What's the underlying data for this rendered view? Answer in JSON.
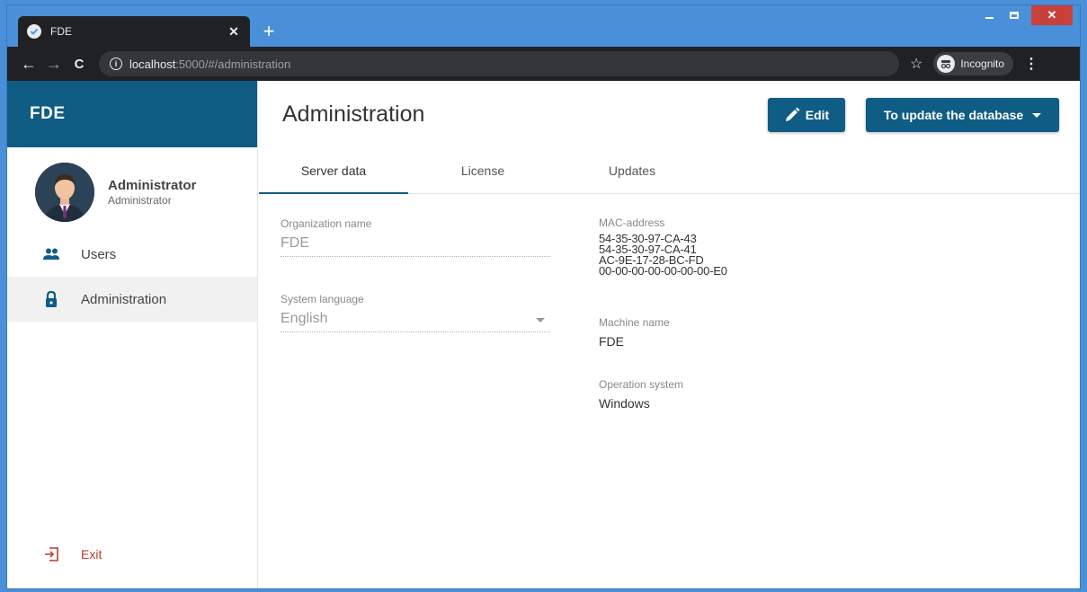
{
  "browser": {
    "tab_title": "FDE",
    "url_host": "localhost",
    "url_rest": ":5000/#/administration",
    "incognito_label": "Incognito",
    "icons": {
      "favicon": "check-circle-icon",
      "back": "arrow-left-icon",
      "forward": "arrow-right-icon",
      "reload": "reload-icon",
      "info": "info-icon",
      "star": "star-icon",
      "incognito": "incognito-icon",
      "menu": "kebab-menu-icon"
    }
  },
  "app": {
    "brand": "FDE",
    "colors": {
      "primary": "#0f5c85",
      "danger": "#c0392b"
    },
    "profile": {
      "name": "Administrator",
      "role": "Administrator"
    },
    "nav": [
      {
        "label": "Users",
        "icon": "users-icon",
        "active": false
      },
      {
        "label": "Administration",
        "icon": "lock-icon",
        "active": true
      }
    ],
    "exit_label": "Exit"
  },
  "main": {
    "title": "Administration",
    "edit_label": "Edit",
    "update_label": "To update the database",
    "tabs": [
      "Server data",
      "License",
      "Updates"
    ],
    "active_tab": 0,
    "form": {
      "org_label": "Organization name",
      "org_value": "FDE",
      "lang_label": "System language",
      "lang_value": "English"
    },
    "info": {
      "mac_label": "MAC-address",
      "mac_values": [
        "54-35-30-97-CA-43",
        "54-35-30-97-CA-41",
        "AC-9E-17-28-BC-FD",
        "00-00-00-00-00-00-00-E0"
      ],
      "machine_label": "Machine name",
      "machine_value": "FDE",
      "os_label": "Operation system",
      "os_value": "Windows"
    }
  }
}
